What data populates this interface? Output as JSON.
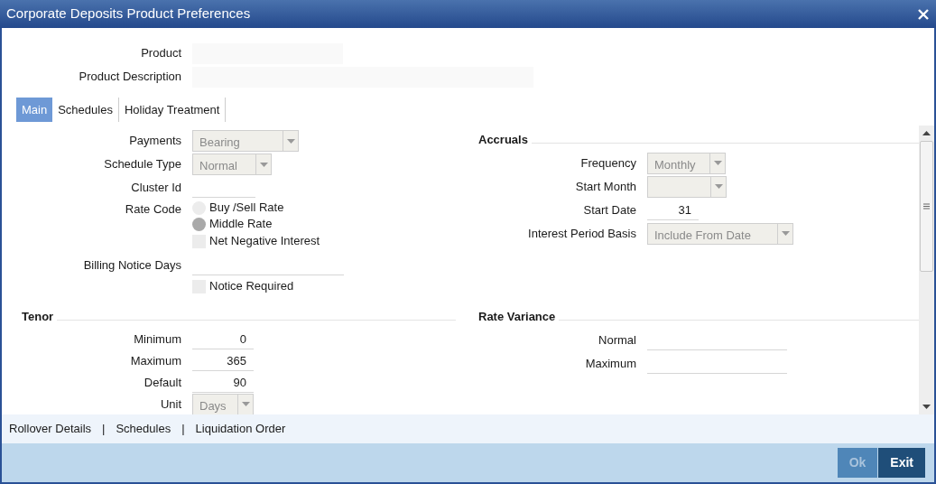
{
  "window": {
    "title": "Corporate Deposits Product Preferences"
  },
  "header_fields": [
    {
      "label": "Product"
    },
    {
      "label": "Product Description"
    }
  ],
  "tabs": [
    {
      "label": "Main",
      "selected": true
    },
    {
      "label": "Schedules",
      "selected": false
    },
    {
      "label": "Holiday Treatment",
      "selected": false
    }
  ],
  "general": [
    {
      "kind": "select",
      "label": "Payments",
      "value": "Bearing",
      "disabled": true
    },
    {
      "kind": "select",
      "label": "Schedule Type",
      "value": "Normal",
      "disabled": true
    },
    {
      "kind": "text",
      "label": "Cluster Id"
    },
    {
      "kind": "radio_group",
      "label": "Rate Code",
      "options": [
        {
          "label": "Buy /Sell Rate",
          "selected": false
        },
        {
          "label": "Middle Rate",
          "selected": true
        }
      ]
    },
    {
      "kind": "checkbox",
      "label": "Net Negative Interest",
      "checked": false
    },
    {
      "kind": "text",
      "label": "Billing Notice Days"
    },
    {
      "kind": "checkbox",
      "label": "Notice Required",
      "checked": false
    }
  ],
  "accruals": {
    "title": "Accruals",
    "fields": [
      {
        "kind": "select",
        "label": "Frequency",
        "value": "Monthly",
        "disabled": true
      },
      {
        "kind": "select",
        "label": "Start Month",
        "disabled": true
      },
      {
        "kind": "text",
        "label": "Start Date",
        "value": "31"
      },
      {
        "kind": "select",
        "label": "Interest Period Basis",
        "value": "Include From Date",
        "disabled": true
      }
    ]
  },
  "tenor": {
    "title": "Tenor",
    "fields": [
      {
        "kind": "text",
        "label": "Minimum",
        "value": "0"
      },
      {
        "kind": "text",
        "label": "Maximum",
        "value": "365"
      },
      {
        "kind": "text",
        "label": "Default",
        "value": "90"
      },
      {
        "kind": "select",
        "label": "Unit",
        "value": "Days",
        "disabled": true
      }
    ]
  },
  "rate_variance": {
    "title": "Rate Variance",
    "fields": [
      {
        "kind": "text",
        "label": "Normal"
      },
      {
        "kind": "text",
        "label": "Maximum"
      }
    ]
  },
  "footer_links": [
    {
      "kind": "link",
      "label": "Rollover Details"
    },
    {
      "kind": "separator",
      "label": "|"
    },
    {
      "kind": "link",
      "label": "Schedules"
    },
    {
      "kind": "separator",
      "label": "|"
    },
    {
      "kind": "link",
      "label": "Liquidation Order"
    }
  ],
  "buttons": [
    {
      "label": "Ok",
      "disabled": true
    },
    {
      "label": "Exit",
      "disabled": false
    }
  ]
}
